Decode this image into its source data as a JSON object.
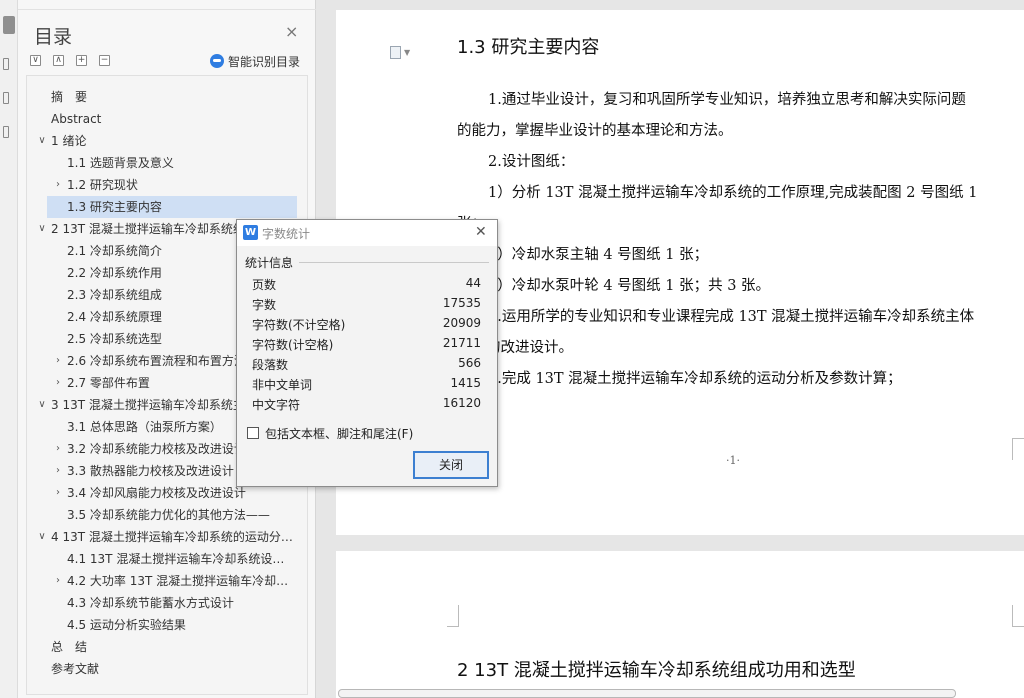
{
  "toc": {
    "title": "目录",
    "close_glyph": "×",
    "toolbar": [
      "∨",
      "∧",
      "+",
      "−"
    ],
    "smart_label": "智能识别目录",
    "items": [
      {
        "label": "摘　要",
        "chevron": ""
      },
      {
        "label": "Abstract",
        "chevron": ""
      },
      {
        "label": "1 绪论",
        "chevron": "∨"
      },
      {
        "label": "1.1 选题背景及意义",
        "chevron": ""
      },
      {
        "label": "1.2 研究现状",
        "chevron": "›"
      },
      {
        "label": "1.3 研究主要内容",
        "chevron": "",
        "selected": true
      },
      {
        "label": "2 13T 混凝土搅拌运输车冷却系统组",
        "chevron": "∨"
      },
      {
        "label": "2.1  冷却系统简介",
        "chevron": ""
      },
      {
        "label": "2.2  冷却系统作用",
        "chevron": ""
      },
      {
        "label": "2.3  冷却系统组成",
        "chevron": ""
      },
      {
        "label": "2.4  冷却系统原理",
        "chevron": ""
      },
      {
        "label": "2.5  冷却系统选型",
        "chevron": ""
      },
      {
        "label": "2.6 冷却系统布置流程和布置方法",
        "chevron": "›"
      },
      {
        "label": "2.7 零部件布置",
        "chevron": "›"
      },
      {
        "label": "3 13T 混凝土搅拌运输车冷却系统主",
        "chevron": "∨"
      },
      {
        "label": "3.1  总体思路（油泵所方案）",
        "chevron": ""
      },
      {
        "label": "3.2 冷却系统能力校核及改进设计",
        "chevron": "›"
      },
      {
        "label": "3.3 散热器能力校核及改进设计",
        "chevron": "›"
      },
      {
        "label": "3.4 冷却风扇能力校核及改进设计",
        "chevron": "›"
      },
      {
        "label": "3.5 冷却系统能力优化的其他方法——",
        "chevron": ""
      },
      {
        "label": "4 13T 混凝土搅拌运输车冷却系统的运动分…",
        "chevron": "∨"
      },
      {
        "label": "4.1 13T 混凝土搅拌运输车冷却系统设…",
        "chevron": ""
      },
      {
        "label": "4.2 大功率 13T 混凝土搅拌运输车冷却…",
        "chevron": "›"
      },
      {
        "label": "4.3 冷却系统节能蓄水方式设计",
        "chevron": ""
      },
      {
        "label": "4.5 运动分析实验结果",
        "chevron": ""
      },
      {
        "label": "总　结",
        "chevron": ""
      },
      {
        "label": "参考文献",
        "chevron": ""
      }
    ]
  },
  "document": {
    "heading": "1.3 研究主要内容",
    "lines": [
      "1.通过毕业设计，复习和巩固所学专业知识，培养独立思考和解决实际问题",
      "的能力，掌握毕业设计的基本理论和方法。",
      "2.设计图纸：",
      "1）分析 13T 混凝土搅拌运输车冷却系统的工作原理,完成装配图 2 号图纸 1",
      "张；",
      "2）冷却水泵主轴 4 号图纸 1 张；",
      "3）冷却水泵叶轮 4 号图纸 1 张；共 3 张。",
      "3.运用所学的专业知识和专业课程完成 13T 混凝土搅拌运输车冷却系统主体",
      "结构的改进设计。",
      "4.完成 13T 混凝土搅拌运输车冷却系统的运动分析及参数计算；"
    ],
    "page_number": "·1·",
    "page2_heading": "2 13T 混凝土搅拌运输车冷却系统组成功用和选型"
  },
  "word_count": {
    "title": "字数统计",
    "close_glyph": "✕",
    "group_label": "统计信息",
    "rows": [
      {
        "label": "页数",
        "value": "44"
      },
      {
        "label": "字数",
        "value": "17535"
      },
      {
        "label": "字符数(不计空格)",
        "value": "20909"
      },
      {
        "label": "字符数(计空格)",
        "value": "21711"
      },
      {
        "label": "段落数",
        "value": "566"
      },
      {
        "label": "非中文单词",
        "value": "1415"
      },
      {
        "label": "中文字符",
        "value": "16120"
      }
    ],
    "checkbox_label": "包括文本框、脚注和尾注(F)",
    "checkbox_checked": false,
    "close_button": "关闭"
  }
}
